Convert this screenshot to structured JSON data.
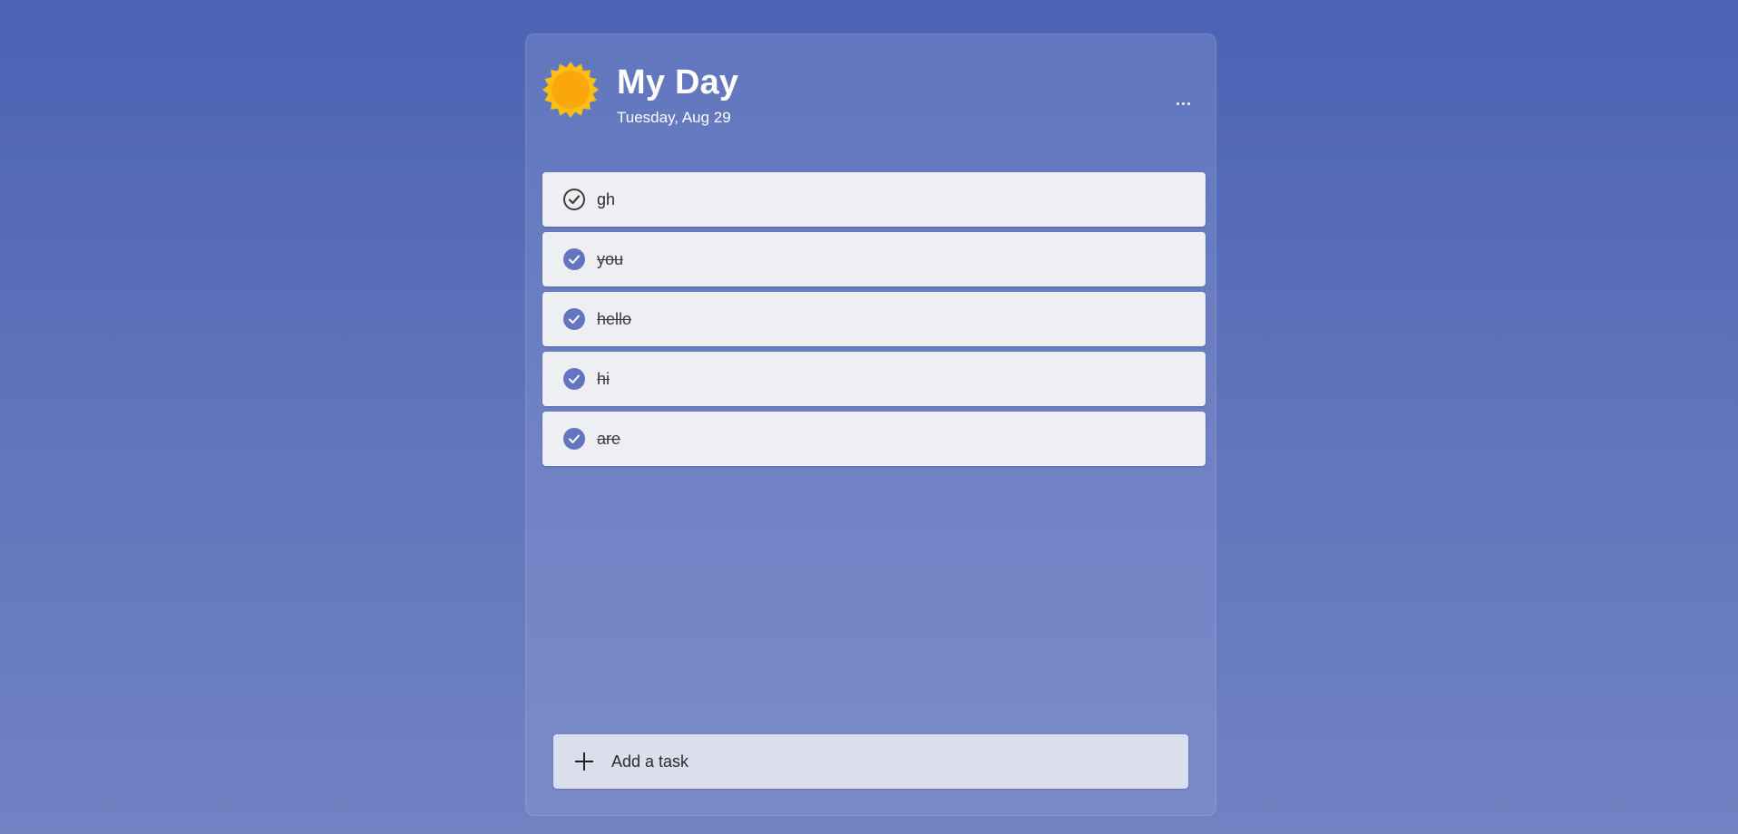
{
  "header": {
    "title": "My Day",
    "date": "Tuesday, Aug 29",
    "icon": "sun-icon",
    "menu_icon": "more-icon"
  },
  "tasks": [
    {
      "label": "gh",
      "completed": false
    },
    {
      "label": "you",
      "completed": true
    },
    {
      "label": "hello",
      "completed": true
    },
    {
      "label": "hi",
      "completed": true
    },
    {
      "label": "are",
      "completed": true
    }
  ],
  "add_task": {
    "label": "Add a task",
    "icon": "plus-icon"
  },
  "colors": {
    "accent": "#6475c0",
    "sun": "#fbbe12",
    "sun_core": "#f9a70a",
    "background": "#4b63b4",
    "task_bg": "#eeeff3",
    "add_bg": "#dadeed"
  }
}
